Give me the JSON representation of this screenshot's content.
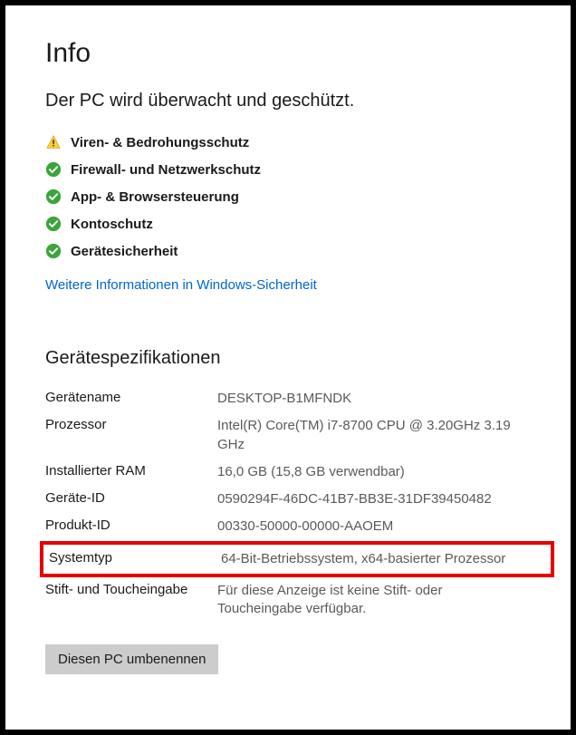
{
  "page_title": "Info",
  "security": {
    "heading": "Der PC wird überwacht und geschützt.",
    "items": [
      {
        "icon": "warning",
        "label": "Viren- & Bedrohungsschutz"
      },
      {
        "icon": "check",
        "label": "Firewall- und Netzwerkschutz"
      },
      {
        "icon": "check",
        "label": "App- & Browsersteuerung"
      },
      {
        "icon": "check",
        "label": "Kontoschutz"
      },
      {
        "icon": "check",
        "label": "Gerätesicherheit"
      }
    ],
    "more_link": "Weitere Informationen in Windows-Sicherheit"
  },
  "specs": {
    "heading": "Gerätespezifikationen",
    "rows": [
      {
        "label": "Gerätename",
        "value": "DESKTOP-B1MFNDK",
        "highlight": false
      },
      {
        "label": "Prozessor",
        "value": "Intel(R) Core(TM) i7-8700 CPU @ 3.20GHz   3.19 GHz",
        "highlight": false
      },
      {
        "label": "Installierter RAM",
        "value": "16,0 GB (15,8 GB verwendbar)",
        "highlight": false
      },
      {
        "label": "Geräte-ID",
        "value": "0590294F-46DC-41B7-BB3E-31DF39450482",
        "highlight": false
      },
      {
        "label": "Produkt-ID",
        "value": "00330-50000-00000-AAOEM",
        "highlight": false
      },
      {
        "label": "Systemtyp",
        "value": "64-Bit-Betriebssystem, x64-basierter Prozessor",
        "highlight": true
      },
      {
        "label": "Stift- und Toucheingabe",
        "value": "Für diese Anzeige ist keine Stift- oder Toucheingabe verfügbar.",
        "highlight": false
      }
    ],
    "rename_button": "Diesen PC umbenennen"
  },
  "icons": {
    "warning": "warning-icon",
    "check": "check-icon"
  }
}
